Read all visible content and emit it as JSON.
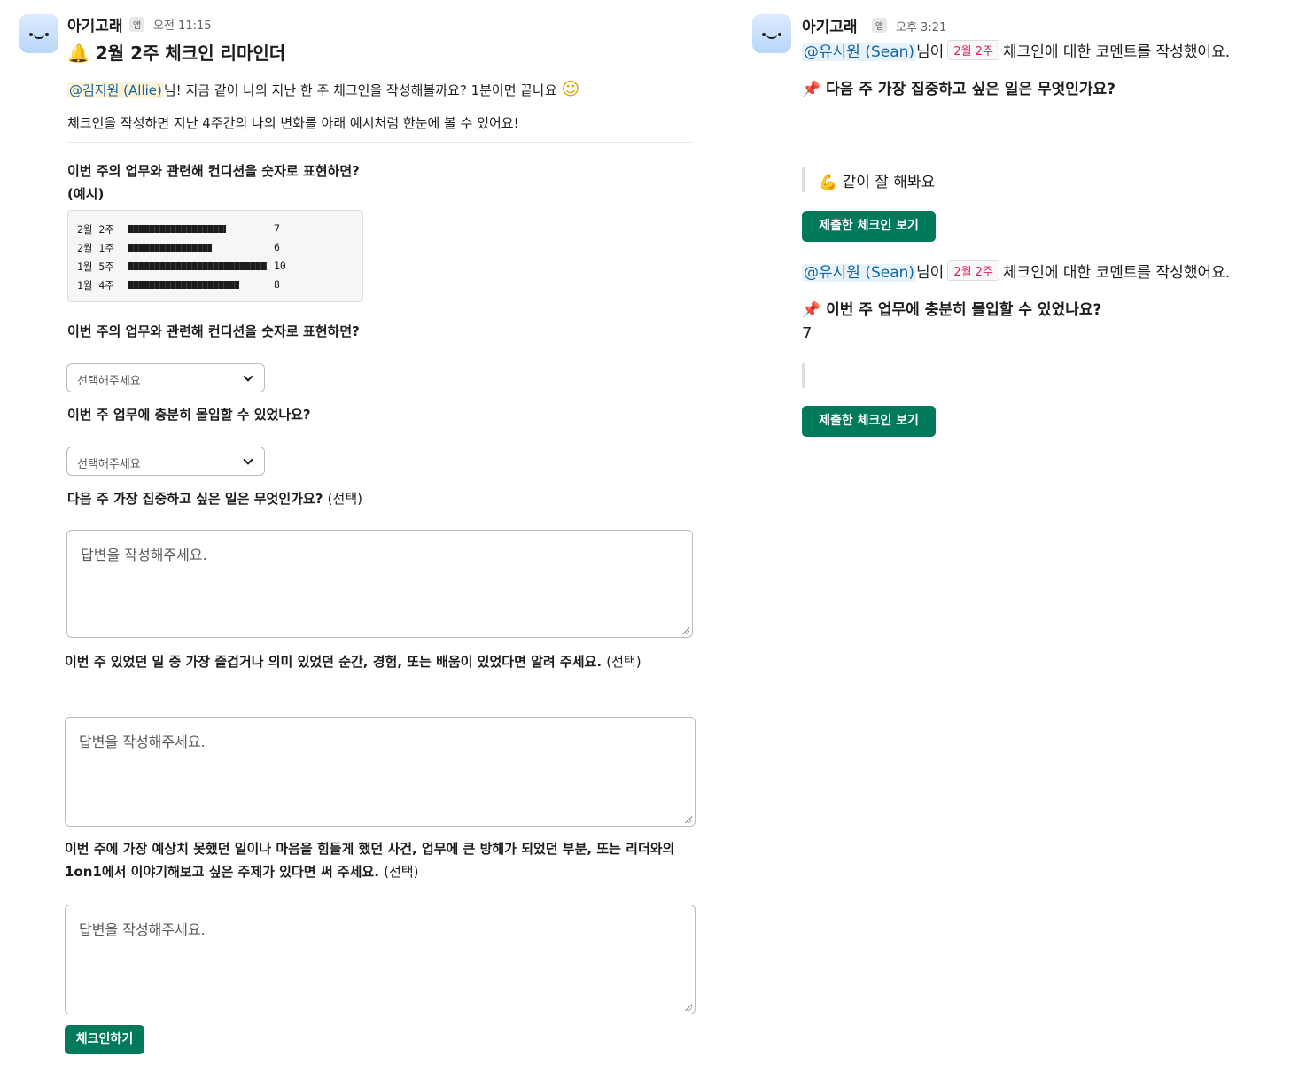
{
  "left": {
    "sender": "아기고래",
    "app_badge": "앱",
    "time": "오전 11:15",
    "title": "2월 2주 체크인 리마인더",
    "title_icon": "bell-icon",
    "greeting": {
      "mention": "@김지원 (Allie)",
      "text": "님! 지금 같이 나의 지난 한 주 체크인을 작성해볼까요? 1분이면 끝나요",
      "emoji": "☺"
    },
    "intro": "체크인을 작성하면 지난 4주간의 나의 변화를 아래 예시처럼 한눈에 볼 수 있어요!",
    "example_label": "이번 주의 업무와 관련해 컨디션을 숫자로 표현하면?(예시)",
    "example_rows": [
      {
        "week": "2월 2주",
        "value": 7
      },
      {
        "week": "2월 1주",
        "value": 6
      },
      {
        "week": "1월 5주",
        "value": 10
      },
      {
        "week": "1월 4주",
        "value": 8
      }
    ],
    "q1": {
      "label": "이번 주의 업무와 관련해 컨디션을 숫자로 표현하면?",
      "placeholder": "선택해주세요"
    },
    "q2": {
      "label": "이번 주 업무에 충분히 몰입할 수 있었나요?",
      "placeholder": "선택해주세요"
    },
    "q3": {
      "label": "다음 주 가장 집중하고 싶은 일은 무엇인가요?",
      "optional": "(선택)",
      "placeholder": "답변을 작성해주세요."
    },
    "q4": {
      "label": "이번 주 있었던 일 중 가장 즐겁거나 의미 있었던 순간, 경험, 또는 배움이 있었다면 알려 주세요.",
      "optional": "(선택)",
      "placeholder": "답변을 작성해주세요."
    },
    "q5": {
      "label": "이번 주에 가장 예상치 못했던 일이나 마음을 힘들게 했던 사건, 업무에 큰 방해가 되었던 부분, 또는 리더와의 1on1에서 이야기해보고 싶은 주제가 있다면 써 주세요.",
      "optional": "(선택)",
      "placeholder": "답변을 작성해주세요."
    },
    "submit_button": "체크인하기"
  },
  "right": {
    "sender": "아기고래",
    "app_badge": "앱",
    "time": "오후 3:21",
    "comment1": {
      "mention": "@유시원 (Sean)",
      "suffix": "님이",
      "date_badge": "2월 2주",
      "text": "체크인에 대한 코멘트를 작성했어요.",
      "question": "다음 주 가장 집중하고 싶은 일은 무엇인가요?",
      "quote": "같이 잘 해봐요",
      "quote_emoji": "💪",
      "button": "제출한 체크인 보기"
    },
    "comment2": {
      "mention": "@유시원 (Sean)",
      "suffix": "님이",
      "date_badge": "2월 2주",
      "text": "체크인에 대한 코멘트를 작성했어요.",
      "question": "이번 주 업무에 충분히 몰입할 수 있었나요?",
      "answer": "7",
      "button": "제출한 체크인 보기"
    }
  },
  "colors": {
    "accent_button": "#007a5a",
    "mention_bg": "#fdf3d7",
    "mention_text": "#1264a3",
    "date_badge": "#e01e5a"
  }
}
